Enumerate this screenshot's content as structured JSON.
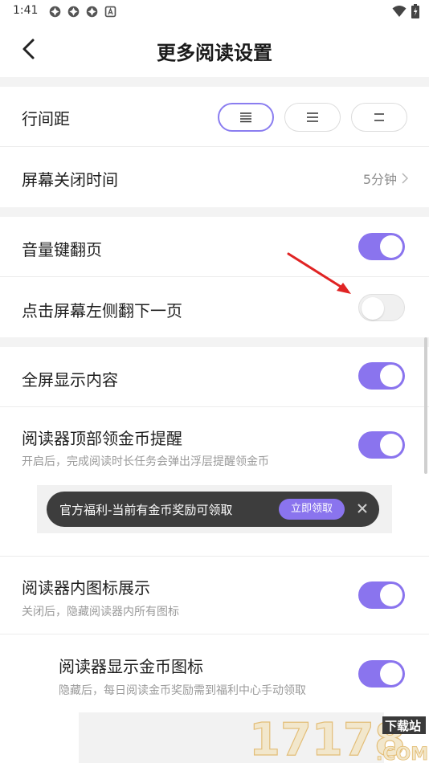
{
  "status_bar": {
    "time": "1:41",
    "icons_left": [
      "app-notification-icon",
      "app-notification-icon",
      "app-notification-icon",
      "a-letter-icon"
    ],
    "icons_right": [
      "wifi-icon",
      "battery-charging-icon"
    ]
  },
  "header": {
    "title": "更多阅读设置",
    "back_icon": "chevron-left-icon"
  },
  "settings": {
    "line_spacing": {
      "label": "行间距",
      "options": [
        "compact",
        "normal",
        "loose"
      ],
      "selected_index": 0
    },
    "screen_off": {
      "label": "屏幕关闭时间",
      "value": "5分钟"
    },
    "volume_page": {
      "label": "音量键翻页",
      "enabled": true
    },
    "tap_left": {
      "label": "点击屏幕左侧翻下一页",
      "enabled": false
    },
    "fullscreen": {
      "label": "全屏显示内容",
      "enabled": true
    },
    "gold_reminder": {
      "label": "阅读器顶部领金币提醒",
      "sub": "开启后，完成阅读时长任务会弹出浮层提醒领金币",
      "enabled": true
    },
    "promo": {
      "text": "官方福利-当前有金币奖励可领取",
      "button": "立即领取"
    },
    "reader_icons": {
      "label": "阅读器内图标展示",
      "sub": "关闭后，隐藏阅读器内所有图标",
      "enabled": true
    },
    "gold_icon": {
      "label": "阅读器显示金币图标",
      "sub": "隐藏后，每日阅读金币奖励需到福利中心手动领取",
      "enabled": true
    }
  },
  "watermark": {
    "number": "17178",
    "tag": "下载站",
    "domain": ".COM"
  },
  "colors": {
    "accent": "#8a74ee",
    "toggle_off": "#f0f0f0",
    "band": "#f3f3f3",
    "annotation_arrow": "#e02424"
  }
}
